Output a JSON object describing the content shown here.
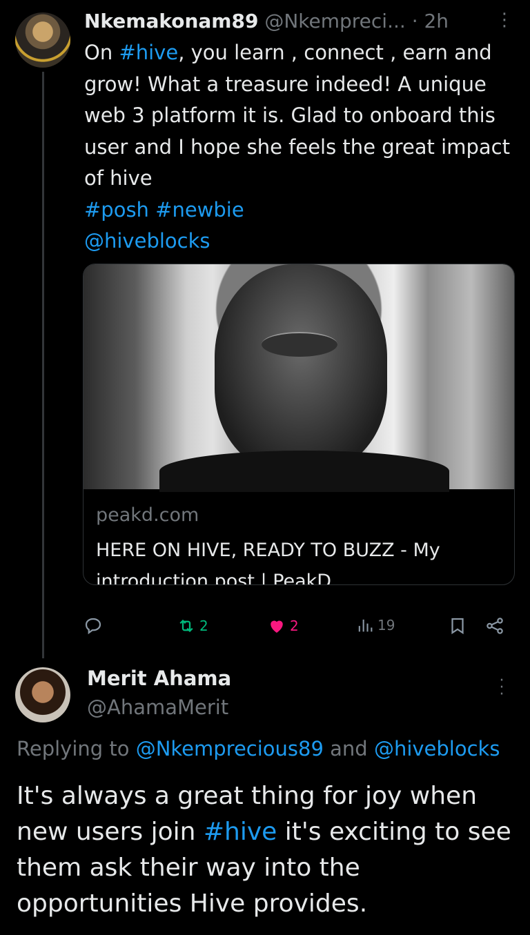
{
  "tweet": {
    "author_name": "Nkemakonam89",
    "author_handle": "@Nkempreci...",
    "time": "· 2h",
    "body": {
      "line1_prefix": "On ",
      "line1_tag": "#hive",
      "line1_suffix": ", you learn , connect , earn and grow! What a treasure indeed! A unique web 3 platform it is. Glad to onboard this user and I hope she feels the great impact of hive",
      "tags_line": "#posh #newbie",
      "mention_line": "@hiveblocks"
    },
    "card": {
      "domain": "peakd.com",
      "title": "HERE ON HIVE, READY TO BUZZ - My introduction post | PeakD"
    },
    "actions": {
      "retweets": "2",
      "likes": "2",
      "views": "19"
    },
    "icons": {
      "reply": "reply-icon",
      "retweet": "retweet-icon",
      "like": "heart-icon",
      "views": "views-icon",
      "bookmark": "bookmark-icon",
      "share": "share-icon",
      "more": "more-icon"
    }
  },
  "reply": {
    "author_name": "Merit Ahama",
    "author_handle": "@AhamaMerit",
    "replying_label": "Replying to ",
    "replying_user1": "@Nkemprecious89",
    "replying_and": " and ",
    "replying_user2": "@hiveblocks",
    "body_prefix": "It's always a great thing for joy when new users join ",
    "body_tag": "#hive",
    "body_suffix": " it's exciting to see them ask their way into the opportunities Hive provides."
  },
  "colors": {
    "background": "#000000",
    "link": "#1d9bf0",
    "muted": "#71767b",
    "retweet": "#00ba7c",
    "like": "#f91880"
  }
}
